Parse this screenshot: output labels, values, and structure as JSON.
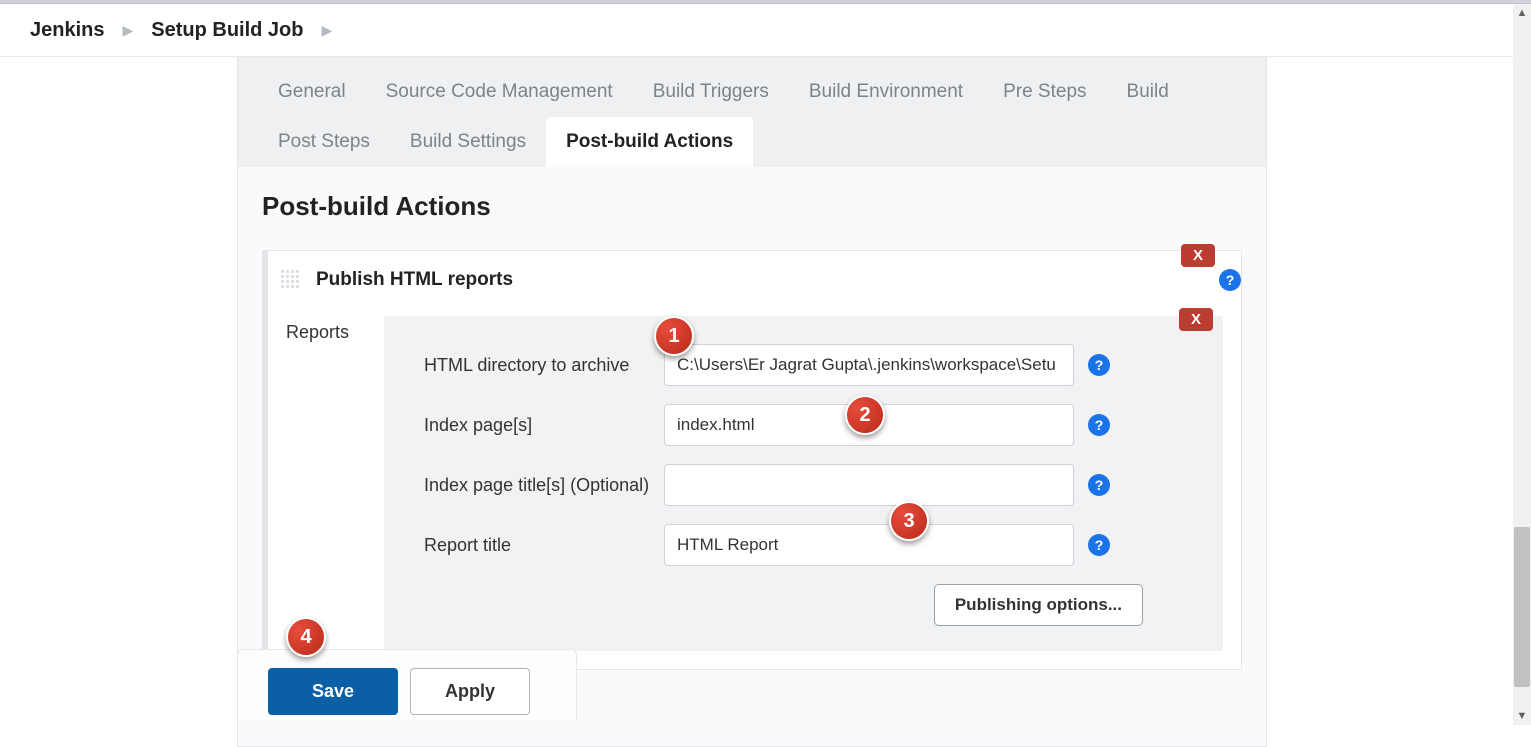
{
  "breadcrumb": {
    "root": "Jenkins",
    "job": "Setup Build Job"
  },
  "tabs": [
    {
      "label": "General"
    },
    {
      "label": "Source Code Management"
    },
    {
      "label": "Build Triggers"
    },
    {
      "label": "Build Environment"
    },
    {
      "label": "Pre Steps"
    },
    {
      "label": "Build"
    },
    {
      "label": "Post Steps"
    },
    {
      "label": "Build Settings"
    },
    {
      "label": "Post-build Actions"
    }
  ],
  "page": {
    "title": "Post-build Actions"
  },
  "section": {
    "title": "Publish HTML reports",
    "close": "X",
    "helpGlyph": "?",
    "reportsLabel": "Reports"
  },
  "fields": {
    "dir": {
      "label": "HTML directory to archive",
      "value": "C:\\Users\\Er Jagrat Gupta\\.jenkins\\workspace\\Setu"
    },
    "index": {
      "label": "Index page[s]",
      "value": "index.html"
    },
    "indexTitle": {
      "label": "Index page title[s] (Optional)",
      "value": ""
    },
    "reportTitle": {
      "label": "Report title",
      "value": "HTML Report"
    }
  },
  "buttons": {
    "publishing": "Publishing options...",
    "save": "Save",
    "apply": "Apply"
  },
  "annotations": {
    "a1": "1",
    "a2": "2",
    "a3": "3",
    "a4": "4"
  }
}
